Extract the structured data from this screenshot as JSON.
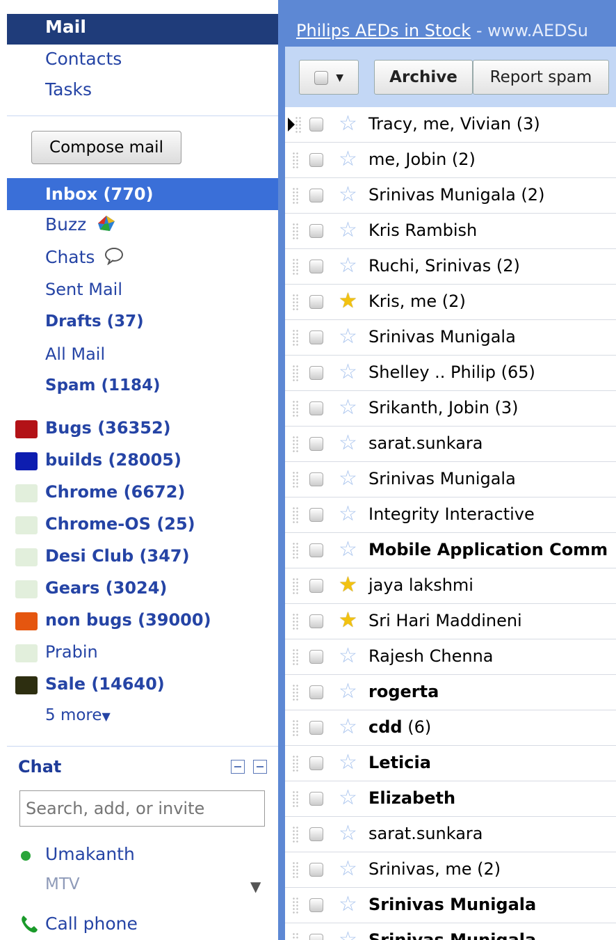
{
  "nav": {
    "top_links": [
      "Mail",
      "Contacts",
      "Tasks"
    ],
    "compose_label": "Compose mail",
    "folders": [
      {
        "label": "Inbox (770)",
        "selected": true,
        "bold": true
      },
      {
        "label": "Buzz",
        "icon": "buzz-icon"
      },
      {
        "label": "Chats",
        "icon": "speech-bubble-icon"
      },
      {
        "label": "Sent Mail"
      },
      {
        "label": "Drafts (37)",
        "bold": true
      },
      {
        "label": "All Mail"
      },
      {
        "label": "Spam (1184)",
        "bold": true
      }
    ],
    "labels": [
      {
        "label": "Bugs (36352)",
        "color": "#b31217",
        "bold": true
      },
      {
        "label": "builds (28005)",
        "color": "#0d1db0",
        "bold": true
      },
      {
        "label": "Chrome (6672)",
        "color": "#e2efdc",
        "bold": true
      },
      {
        "label": "Chrome-OS (25)",
        "color": "#e2efdc",
        "bold": true
      },
      {
        "label": "Desi Club (347)",
        "color": "#e2efdc",
        "bold": true
      },
      {
        "label": "Gears (3024)",
        "color": "#e2efdc",
        "bold": true
      },
      {
        "label": "non bugs (39000)",
        "color": "#e5560f",
        "bold": true
      },
      {
        "label": "Prabin",
        "color": "#e2efdc",
        "bold": false
      },
      {
        "label": "Sale (14640)",
        "color": "#2d2e10",
        "bold": true
      }
    ],
    "more_label": "5 more"
  },
  "chat": {
    "title": "Chat",
    "search_placeholder": "Search, add, or invite",
    "contact": {
      "name": "Umakanth",
      "status": "MTV"
    },
    "call_phone": "Call phone"
  },
  "main": {
    "ad_link": "Philips AEDs in Stock",
    "ad_url": " - www.AEDSu",
    "toolbar": {
      "archive": "Archive",
      "report_spam": "Report spam"
    },
    "messages": [
      {
        "sender": "Tracy, me, Vivian (3)",
        "starred": false,
        "unread": false,
        "pointer": true
      },
      {
        "sender": "me, Jobin (2)",
        "starred": false,
        "unread": false
      },
      {
        "sender": "Srinivas Munigala (2)",
        "starred": false,
        "unread": false
      },
      {
        "sender": "Kris Rambish",
        "starred": false,
        "unread": false
      },
      {
        "sender": "Ruchi, Srinivas (2)",
        "starred": false,
        "unread": false
      },
      {
        "sender": "Kris, me (2)",
        "starred": true,
        "unread": false
      },
      {
        "sender": "Srinivas Munigala",
        "starred": false,
        "unread": false
      },
      {
        "sender": "Shelley .. Philip (65)",
        "starred": false,
        "unread": false
      },
      {
        "sender": "Srikanth, Jobin (3)",
        "starred": false,
        "unread": false
      },
      {
        "sender": "sarat.sunkara",
        "starred": false,
        "unread": false
      },
      {
        "sender": "Srinivas Munigala",
        "starred": false,
        "unread": false
      },
      {
        "sender": "Integrity Interactive",
        "starred": false,
        "unread": false
      },
      {
        "sender": "Mobile Application Comm",
        "starred": false,
        "unread": true
      },
      {
        "sender": "jaya lakshmi",
        "starred": true,
        "unread": false
      },
      {
        "sender": "Sri Hari Maddineni",
        "starred": true,
        "unread": false
      },
      {
        "sender": "Rajesh Chenna",
        "starred": false,
        "unread": false
      },
      {
        "sender": "rogerta",
        "starred": false,
        "unread": true
      },
      {
        "sender": "cdd",
        "count": " (6)",
        "starred": false,
        "unread": true
      },
      {
        "sender": "Leticia",
        "starred": false,
        "unread": true
      },
      {
        "sender": "Elizabeth",
        "starred": false,
        "unread": true
      },
      {
        "sender": "sarat.sunkara",
        "starred": false,
        "unread": false
      },
      {
        "sender": "Srinivas, me (2)",
        "starred": false,
        "unread": false
      },
      {
        "sender": "Srinivas Munigala",
        "starred": false,
        "unread": true
      },
      {
        "sender": "Srinivas Munigala",
        "starred": false,
        "unread": true
      }
    ]
  }
}
